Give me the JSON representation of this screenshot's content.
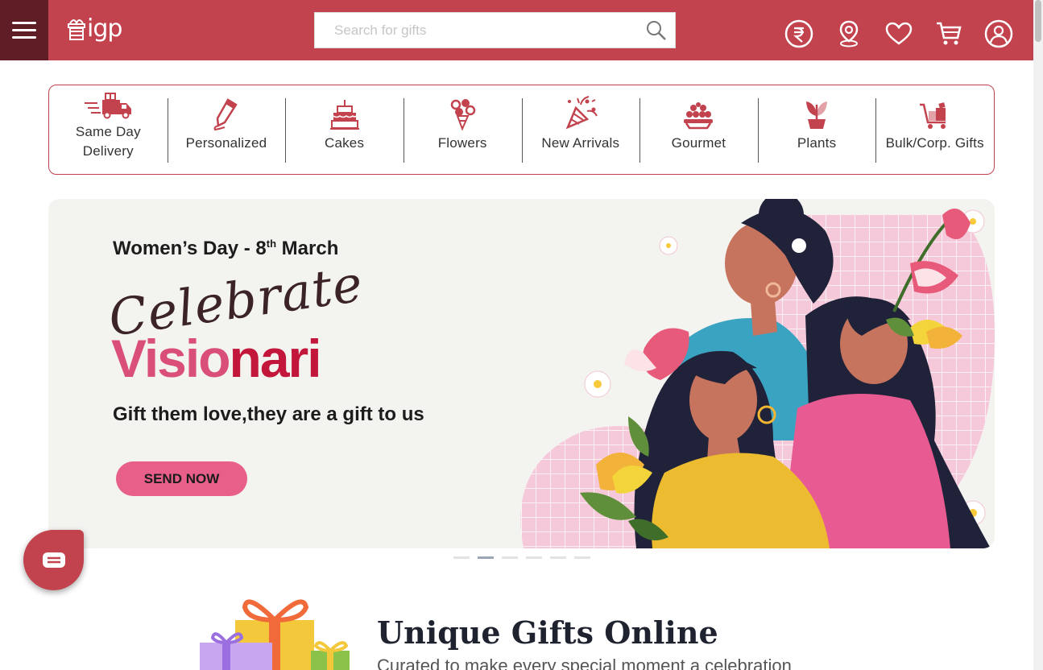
{
  "header": {
    "logo_text": "igp",
    "search_placeholder": "Search for gifts",
    "icons": [
      "rupee-icon",
      "location-pin-icon",
      "heart-icon",
      "cart-icon",
      "user-account-icon"
    ]
  },
  "categories": [
    {
      "label_line1": "Same Day",
      "label_line2": "Delivery",
      "icon": "delivery-truck-icon"
    },
    {
      "label": "Personalized",
      "icon": "pencil-icon"
    },
    {
      "label": "Cakes",
      "icon": "cake-icon"
    },
    {
      "label": "Flowers",
      "icon": "bouquet-icon"
    },
    {
      "label": "New Arrivals",
      "icon": "party-popper-icon"
    },
    {
      "label": "Gourmet",
      "icon": "sweets-platter-icon"
    },
    {
      "label": "Plants",
      "icon": "potted-plant-icon"
    },
    {
      "label": "Bulk/Corp. Gifts",
      "icon": "bulk-cart-icon"
    }
  ],
  "banner": {
    "headline_prefix": "Women’s Day - 8",
    "headline_sup": "th",
    "headline_suffix": " March",
    "script_text": "Celebrate",
    "big_part1": "Visio",
    "big_part2": "nari",
    "tagline": "Gift them love,they are a gift to us",
    "cta": "SEND NOW"
  },
  "carousel": {
    "count": 6,
    "active_index": 1
  },
  "section": {
    "title": "Unique Gifts Online",
    "subtitle": "Curated to make every special moment a celebration"
  },
  "colors": {
    "brand": "#c2434e",
    "brand_dark": "#5f1e25",
    "banner_pink": "#e8608a"
  }
}
